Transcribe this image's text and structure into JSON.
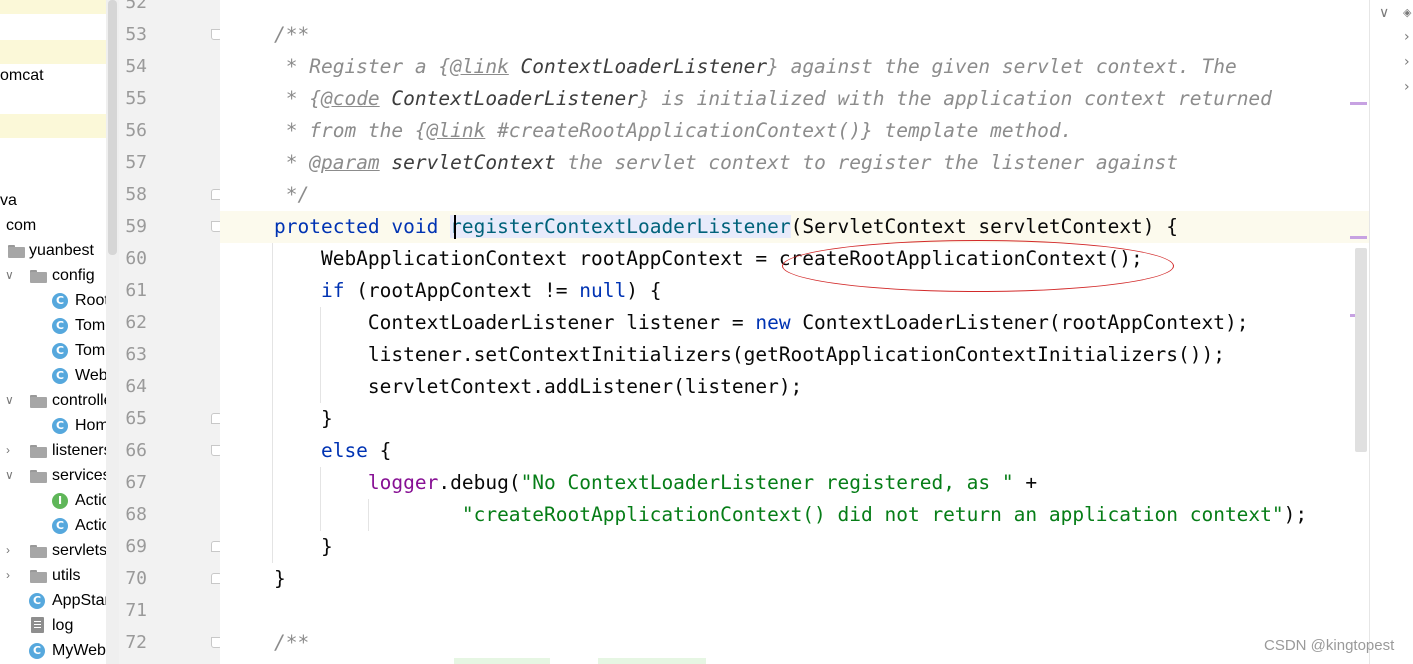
{
  "project_tree": {
    "rows": [
      {
        "label": "omcat"
      },
      {
        "label": "va"
      },
      {
        "label": "com"
      },
      {
        "label": "yuanbest"
      },
      {
        "label": "config"
      },
      {
        "label": "RootC"
      },
      {
        "label": "Tomca"
      },
      {
        "label": "Tomca"
      },
      {
        "label": "WebC"
      },
      {
        "label": "controlle"
      },
      {
        "label": "Home"
      },
      {
        "label": "listeners"
      },
      {
        "label": "services"
      },
      {
        "label": "Action"
      },
      {
        "label": "Action"
      },
      {
        "label": "servlets"
      },
      {
        "label": "utils"
      },
      {
        "label": "AppStart"
      },
      {
        "label": "log"
      },
      {
        "label": "MyWebA"
      }
    ],
    "class_icon_glyph": "C",
    "interface_icon_glyph": "I",
    "arrow_expanded": "∨",
    "arrow_collapsed": "›"
  },
  "gutter": {
    "line_numbers": [
      "52",
      "53",
      "54",
      "55",
      "56",
      "57",
      "58",
      "59",
      "60",
      "61",
      "62",
      "63",
      "64",
      "65",
      "66",
      "67",
      "68",
      "69",
      "70",
      "71",
      "72"
    ]
  },
  "code": {
    "l53": {
      "t1": "/**"
    },
    "l54": {
      "t1": " * Register a {",
      "t2": "@link",
      "t3": " ContextLoaderListener",
      "t4": "} against the given servlet context. The"
    },
    "l55": {
      "t1": " * {",
      "t2": "@code",
      "t3": " ContextLoaderListener",
      "t4": "} is initialized with the application context returned"
    },
    "l56": {
      "t1": " * from the {",
      "t2": "@link",
      "t3": " #createRootApplicationContext()",
      "t4": "} template method."
    },
    "l57": {
      "t1": " * ",
      "t2": "@param",
      "t3": " servletContext",
      "t4": " the servlet context to register the listener against"
    },
    "l58": {
      "t1": " */"
    },
    "l59": {
      "kw1": "protected",
      "kw2": " void ",
      "m": "registerContextLoaderListener",
      "r": "(ServletContext servletContext) {"
    },
    "l60": {
      "t": "    WebApplicationContext rootAppContext = createRootApplicationContext();"
    },
    "l61": {
      "kw": "    if",
      "a": " (rootAppContext != ",
      "kw2": "null",
      "b": ") {"
    },
    "l62": {
      "a": "        ContextLoaderListener listener = ",
      "kw": "new",
      "b": " ContextLoaderListener(rootAppContext);"
    },
    "l63": {
      "t": "        listener.setContextInitializers(getRootApplicationContextInitializers());"
    },
    "l64": {
      "t": "        servletContext.addListener(listener);"
    },
    "l65": {
      "t": "    }"
    },
    "l66": {
      "kw": "    else",
      "a": " {"
    },
    "l67": {
      "pre": "        ",
      "f": "logger",
      "a": ".debug(",
      "s": "\"No ContextLoaderListener registered, as \"",
      "b": " +"
    },
    "l68": {
      "pre": "                ",
      "s": "\"createRootApplicationContext() did not return an application context\"",
      "b": ");"
    },
    "l69": {
      "t": "    }"
    },
    "l70": {
      "t": "}"
    },
    "l72": {
      "t1": "/**"
    }
  },
  "watermark": "CSDN @kingtopest",
  "annotation_color": "#d22a2a"
}
